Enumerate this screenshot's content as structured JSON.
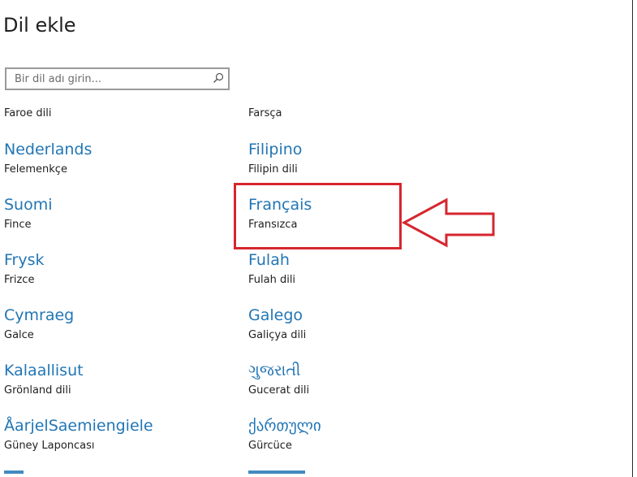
{
  "title": "Dil ekle",
  "search": {
    "placeholder": "Bir dil adı girin...",
    "value": ""
  },
  "languages": {
    "col1": [
      {
        "native": "",
        "local": "Faroe dili"
      },
      {
        "native": "Nederlands",
        "local": "Felemenkçe"
      },
      {
        "native": "Suomi",
        "local": "Fince"
      },
      {
        "native": "Frysk",
        "local": "Frizce"
      },
      {
        "native": "Cymraeg",
        "local": "Galce"
      },
      {
        "native": "Kalaallisut",
        "local": "Grönland dili"
      },
      {
        "native": "ÅarjelSaemiengiele",
        "local": "Güney Laponcası"
      }
    ],
    "col2": [
      {
        "native": "",
        "local": "Farsça"
      },
      {
        "native": "Filipino",
        "local": "Filipin dili"
      },
      {
        "native": "Français",
        "local": "Fransızca"
      },
      {
        "native": "Fulah",
        "local": "Fulah dili"
      },
      {
        "native": "Galego",
        "local": "Galiçya dili"
      },
      {
        "native": "ગુજરાતી",
        "local": "Gucerat dili"
      },
      {
        "native": "ქართული",
        "local": "Gürcüce"
      }
    ]
  },
  "colors": {
    "link_blue": "#2276b5",
    "annotation_red": "#d6262f"
  }
}
